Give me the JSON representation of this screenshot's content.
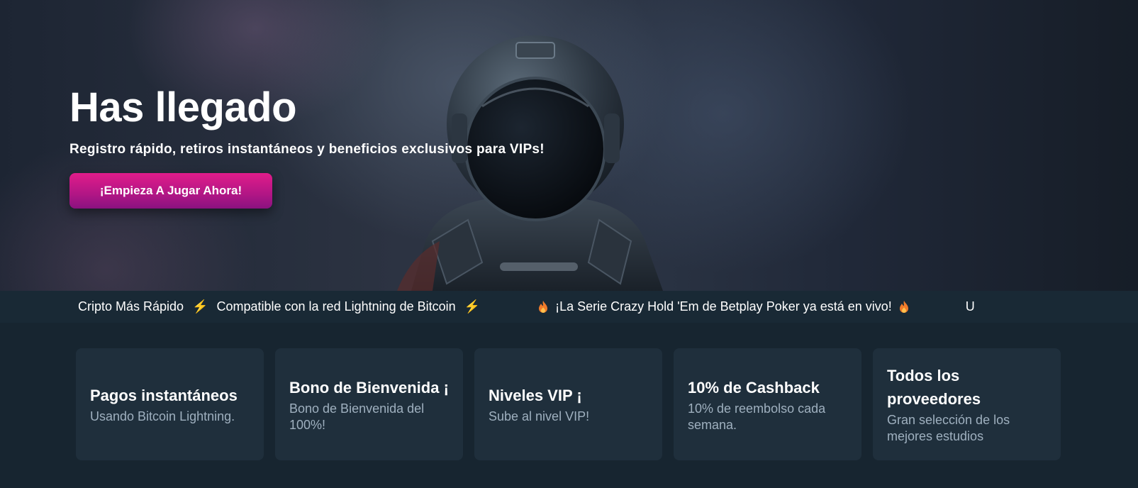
{
  "hero": {
    "title": "Has llegado",
    "subtitle": "Registro rápido, retiros instantáneos y beneficios exclusivos para VIPs!",
    "cta_label": "¡Empieza A Jugar Ahora!"
  },
  "ticker": {
    "item_1": "Cripto Más Rápido",
    "item_2": "Compatible con la red Lightning de Bitcoin",
    "item_3": "¡La Serie Crazy Hold 'Em de Betplay Poker ya está en vivo!",
    "item_4": "U",
    "bolt_icon": "⚡",
    "fire_icon": "fire-icon"
  },
  "features": [
    {
      "title": "Pagos instantáneos",
      "desc": "Usando Bitcoin Lightning."
    },
    {
      "title": "Bono de Bienvenida ¡",
      "desc": "Bono de Bienvenida del 100%!"
    },
    {
      "title": "Niveles VIP ¡",
      "desc": "Sube al nivel VIP!"
    },
    {
      "title": "10% de Cashback",
      "desc": "10% de reembolso cada semana."
    },
    {
      "title": "Todos los proveedores",
      "desc": "Gran selección de los mejores estudios"
    }
  ],
  "colors": {
    "accent": "#e11c8a",
    "background": "#172530",
    "card": "#1f2f3c",
    "muted_text": "#9fb0bf",
    "bolt": "#f07b2a"
  }
}
